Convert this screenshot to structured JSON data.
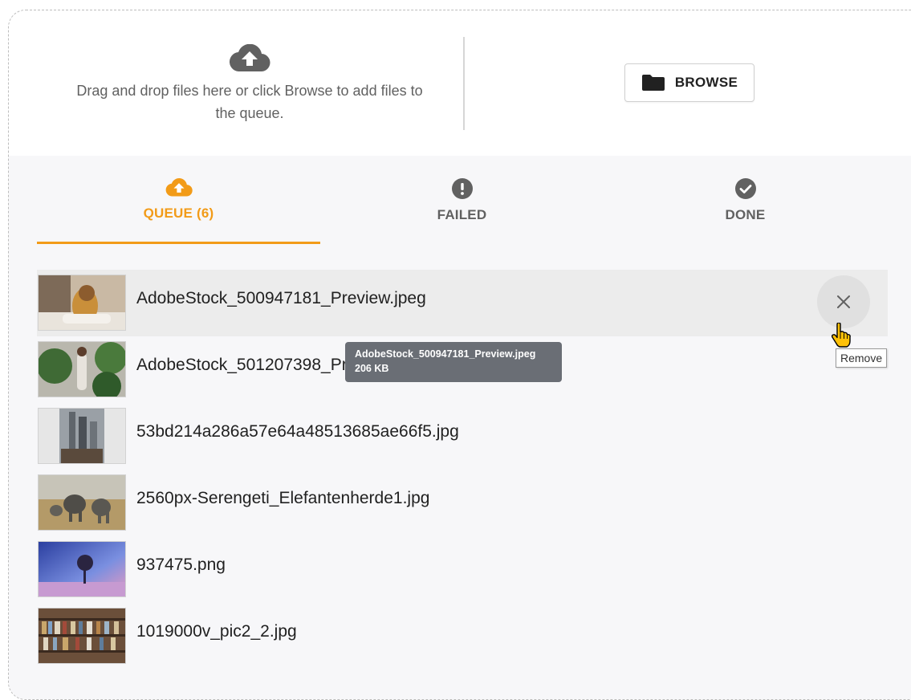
{
  "dropzone": {
    "instruction_line1": "Drag and drop files here or click Browse to add files to",
    "instruction_line2": "the queue.",
    "upload_icon": "cloud-upload-icon",
    "browse_label": "BROWSE",
    "browse_icon": "folder-icon"
  },
  "tabs": [
    {
      "label": "QUEUE (6)",
      "icon": "cloud-upload-icon",
      "active": true
    },
    {
      "label": "FAILED",
      "icon": "exclamation-circle-icon",
      "active": false
    },
    {
      "label": "DONE",
      "icon": "check-circle-icon",
      "active": false
    }
  ],
  "files": [
    {
      "name": "AdobeStock_500947181_Preview.jpeg",
      "thumb": "dog-in-towel"
    },
    {
      "name": "AdobeStock_501207398_Preview.jpeg",
      "thumb": "woman-with-plants"
    },
    {
      "name": "53bd214a286a57e64a48513685ae66f5.jpg",
      "thumb": "city-towers"
    },
    {
      "name": "2560px-Serengeti_Elefantenherde1.jpg",
      "thumb": "elephant-herd"
    },
    {
      "name": "937475.png",
      "thumb": "tree-night-sky"
    },
    {
      "name": "1019000v_pic2_2.jpg",
      "thumb": "bookshelves"
    }
  ],
  "tooltip": {
    "name": "AdobeStock_500947181_Preview.jpeg",
    "size": "206 KB"
  },
  "remove_tooltip": "Remove",
  "colors": {
    "accent": "#f29b18",
    "icon_gray": "#616161",
    "tooltip_bg": "#6a6e75"
  }
}
